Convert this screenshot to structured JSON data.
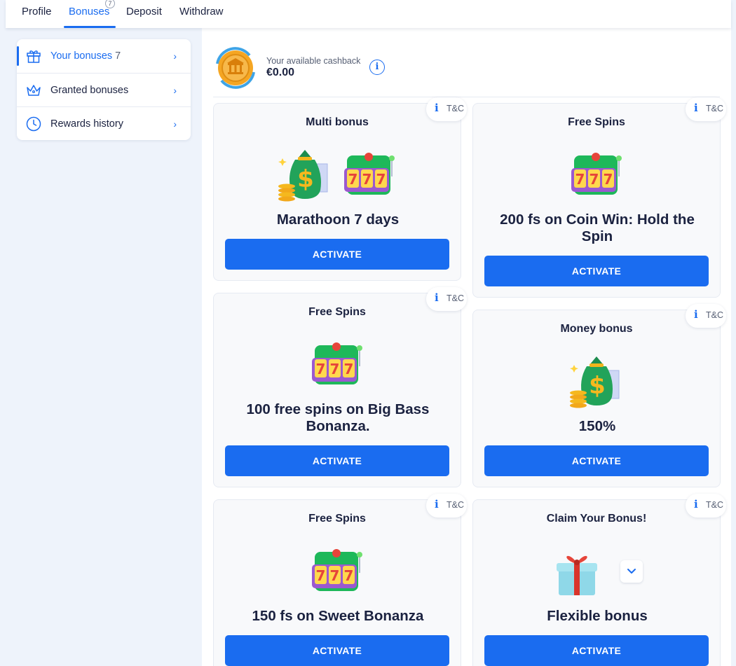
{
  "nav": {
    "tabs": [
      "Profile",
      "Bonuses",
      "Deposit",
      "Withdraw"
    ],
    "active_tab": "Bonuses",
    "bonuses_badge": "7"
  },
  "sidebar": {
    "items": [
      {
        "label": "Your bonuses",
        "count": "7",
        "icon": "gift-icon"
      },
      {
        "label": "Granted bonuses",
        "count": "",
        "icon": "crown-icon"
      },
      {
        "label": "Rewards history",
        "count": "",
        "icon": "clock-icon"
      }
    ],
    "chevron": "›"
  },
  "cashback": {
    "label": "Your available cashback",
    "value": "€0.00",
    "info_glyph": "i"
  },
  "tc": {
    "glyph": "i",
    "label": "T&C"
  },
  "cards": [
    {
      "title": "Multi bonus",
      "name": "Marathoon 7 days",
      "button": "ACTIVATE",
      "art": [
        "money-bag-icon",
        "slot-machine-icon"
      ]
    },
    {
      "title": "Free Spins",
      "name": "200 fs on Coin Win: Hold the Spin",
      "button": "ACTIVATE",
      "art": [
        "slot-machine-icon"
      ]
    },
    {
      "title": "Free Spins",
      "name": "100 free spins on Big Bass Bonanza.",
      "button": "ACTIVATE",
      "art": [
        "slot-machine-icon"
      ]
    },
    {
      "title": "Money bonus",
      "name": "150%",
      "button": "ACTIVATE",
      "art": [
        "money-bag-icon"
      ]
    },
    {
      "title": "Free Spins",
      "name": "150 fs on Sweet Bonanza",
      "button": "ACTIVATE",
      "art": [
        "slot-machine-icon"
      ]
    },
    {
      "title": "Claim Your Bonus!",
      "name": "Flexible bonus",
      "button": "ACTIVATE",
      "art": [
        "gift-box-icon",
        "chevron-down-icon"
      ]
    }
  ],
  "colors": {
    "accent": "#1a6cf0",
    "text": "#1b2240",
    "muted": "#555e73",
    "background": "#eef3fb"
  }
}
